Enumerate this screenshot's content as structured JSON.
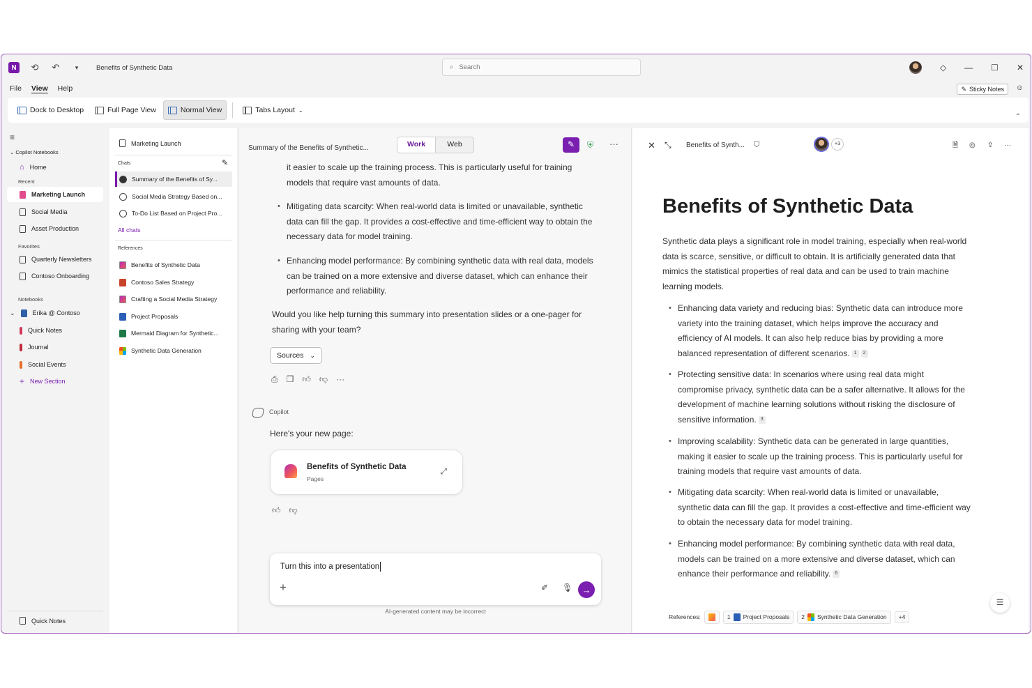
{
  "titlebar": {
    "doc_title": "Benefits of Synthetic Data",
    "search_placeholder": "Search"
  },
  "menu": {
    "file": "File",
    "view": "View",
    "help": "Help"
  },
  "sticky_notes": "Sticky Notes",
  "ribbon": {
    "dock": "Dock to Desktop",
    "full_page": "Full Page View",
    "normal": "Normal View",
    "tabs_layout": "Tabs Layout"
  },
  "nav": {
    "header": "Copilot Notebooks",
    "home": "Home",
    "recent_label": "Recent",
    "recent": [
      "Marketing Launch",
      "Social Media",
      "Asset Production"
    ],
    "favorites_label": "Favorites",
    "favorites": [
      "Quarterly Newsletters",
      "Contoso Onboarding"
    ],
    "notebooks_label": "Notebooks",
    "notebook": "Erika @ Contoso",
    "sections": [
      "Quick Notes",
      "Journal",
      "Social Events"
    ],
    "new_section": "New Section",
    "bottom": "Quick Notes",
    "section_colors": [
      "#d23a5a",
      "#c42a3a",
      "#e8702a"
    ]
  },
  "listpane": {
    "title": "Marketing Launch",
    "chats_label": "Chats",
    "chats": [
      "Summary of the Benefits of Sy...",
      "Social Media Strategy Based on...",
      "To-Do List Based on Project Pro..."
    ],
    "all_chats": "All chats",
    "references_label": "References",
    "references": [
      "Benefits of Synthetic Data",
      "Contoso Sales Strategy",
      "Crafting a Social Media Strategy",
      "Project Proposals",
      "Mermaid Diagram for Synthetic...",
      "Synthetic Data Generation"
    ]
  },
  "chat": {
    "title": "Summary of the Benefits of Synthetic...",
    "toggle_work": "Work",
    "toggle_web": "Web",
    "b0_cont": "it easier to scale up the training process. This is particularly useful for training models that require vast amounts of data.",
    "b1": "Mitigating data scarcity: When real-world data is limited or unavailable, synthetic data can fill the gap. It provides a cost-effective and time-efficient way to obtain the necessary data for model training.",
    "b2": "Enhancing model performance: By combining synthetic data with real data, models can be trained on a more extensive and diverse dataset, which can enhance their performance and reliability.",
    "question": "Would you like help turning this summary into presentation slides or a one-pager for sharing with your team?",
    "sources": "Sources",
    "copilot_label": "Copilot",
    "new_page_msg": "Here's your new page:",
    "card_title": "Benefits of Synthetic Data",
    "card_sub": "Pages",
    "composer_text": "Turn this into a presentation",
    "disclaimer": "AI-generated content may be incorrect"
  },
  "doc": {
    "header_title": "Benefits of Synth...",
    "collab_count": "+3",
    "title": "Benefits of Synthetic Data",
    "intro": "Synthetic data plays a significant role in model training, especially when real-world data is scarce, sensitive, or difficult to obtain. It is artificially generated data that mimics the statistical properties of real data and can be used to train machine learning models.",
    "b1": "Enhancing data variety and reducing bias: Synthetic data can introduce more variety into the training dataset, which helps improve the accuracy and efficiency of AI models. It can also help reduce bias by providing a more balanced representation of different scenarios.",
    "b1_c1": "1",
    "b1_c2": "2",
    "b2": "Protecting sensitive data: In scenarios where using real data might compromise privacy, synthetic data can be a safer alternative. It allows for the development of machine learning solutions without risking the disclosure of sensitive information.",
    "b2_c": "3",
    "b3": "Improving scalability: Synthetic data can be generated in large quantities, making it easier to scale up the training process. This is particularly useful for training models that require vast amounts of data.",
    "b4": "Mitigating data scarcity: When real-world data is limited or unavailable, synthetic data can fill the gap. It provides a cost-effective and time-efficient way to obtain the necessary data for model training.",
    "b5": "Enhancing model performance: By combining synthetic data with real data, models can be trained on a more extensive and diverse dataset, which can enhance their performance and reliability.",
    "b5_c": "6",
    "refs_label": "References:",
    "ref1_num": "1",
    "ref1": "Project Proposals",
    "ref2_num": "2",
    "ref2": "Synthetic Data Generation",
    "refs_more": "+4"
  },
  "colors": {
    "accent": "#7a1fb0",
    "border": "#a35fbf"
  }
}
